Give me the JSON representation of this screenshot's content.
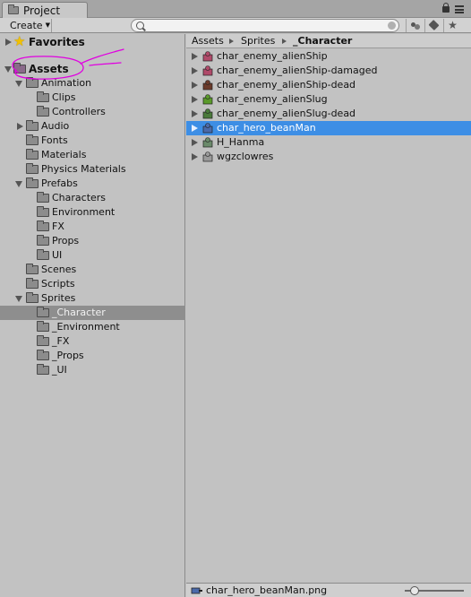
{
  "window": {
    "tab_title": "Project",
    "tab_icon": "folder-icon",
    "title_icons": [
      "lock-icon",
      "menu-icon"
    ]
  },
  "toolbar": {
    "create_label": "Create",
    "search": {
      "value": "",
      "placeholder": ""
    },
    "buttons": [
      "filter-by-type-icon",
      "filter-by-label-icon",
      "favorite-star-icon"
    ]
  },
  "tree": {
    "favorites": {
      "label": "Favorites",
      "icon": "star-icon",
      "expanded": false
    },
    "assets": {
      "label": "Assets",
      "icon": "folder-icon",
      "expanded": true
    },
    "items": [
      {
        "label": "Animation",
        "depth": 1,
        "expanded": true
      },
      {
        "label": "Clips",
        "depth": 2
      },
      {
        "label": "Controllers",
        "depth": 2
      },
      {
        "label": "Audio",
        "depth": 1,
        "expanded": false
      },
      {
        "label": "Fonts",
        "depth": 1
      },
      {
        "label": "Materials",
        "depth": 1
      },
      {
        "label": "Physics Materials",
        "depth": 1
      },
      {
        "label": "Prefabs",
        "depth": 1,
        "expanded": true
      },
      {
        "label": "Characters",
        "depth": 2
      },
      {
        "label": "Environment",
        "depth": 2
      },
      {
        "label": "FX",
        "depth": 2
      },
      {
        "label": "Props",
        "depth": 2
      },
      {
        "label": "UI",
        "depth": 2
      },
      {
        "label": "Scenes",
        "depth": 1
      },
      {
        "label": "Scripts",
        "depth": 1
      },
      {
        "label": "Sprites",
        "depth": 1,
        "expanded": true
      },
      {
        "label": "_Character",
        "depth": 2,
        "selected": true
      },
      {
        "label": "_Environment",
        "depth": 2
      },
      {
        "label": "_FX",
        "depth": 2
      },
      {
        "label": "_Props",
        "depth": 2
      },
      {
        "label": "_UI",
        "depth": 2
      }
    ],
    "selected_color": "#8e8e8e"
  },
  "breadcrumb": [
    "Assets",
    "Sprites",
    "_Character"
  ],
  "assets": [
    {
      "label": "char_enemy_alienShip",
      "thumb_color": "#b04a6a"
    },
    {
      "label": "char_enemy_alienShip-damaged",
      "thumb_color": "#b04a6a"
    },
    {
      "label": "char_enemy_alienShip-dead",
      "thumb_color": "#6a3a2a"
    },
    {
      "label": "char_enemy_alienSlug",
      "thumb_color": "#5a9a2a"
    },
    {
      "label": "char_enemy_alienSlug-dead",
      "thumb_color": "#4a7a3a"
    },
    {
      "label": "char_hero_beanMan",
      "thumb_color": "#4a6aaa",
      "selected": true
    },
    {
      "label": "H_Hanma",
      "thumb_color": "#6a8a6a"
    },
    {
      "label": "wgzclowres",
      "thumb_color": "#9a9a9a"
    }
  ],
  "selection_color": "#3d8ee5",
  "status": {
    "selected_file": "char_hero_beanMan.png",
    "zoom_level": 0.1
  },
  "annotation_color": "#e000e0"
}
